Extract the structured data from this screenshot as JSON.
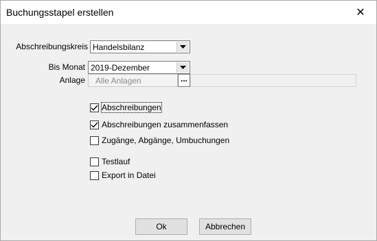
{
  "window": {
    "title": "Buchungsstapel erstellen",
    "close_glyph": "✕"
  },
  "form": {
    "abschreibungskreis": {
      "label": "Abschreibungskreis",
      "value": "Handelsbilanz"
    },
    "bis_monat": {
      "label": "Bis Monat",
      "value": "2019-Dezember"
    },
    "anlage": {
      "label": "Anlage",
      "value": "Alle Anlagen",
      "button_label": "..."
    }
  },
  "options": [
    {
      "label": "Abschreibungen",
      "checked": true,
      "focused": true
    },
    {
      "label": "Abschreibungen zusammenfassen",
      "checked": true,
      "focused": false
    },
    {
      "label": "Zugänge, Abgänge, Umbuchungen",
      "checked": false,
      "focused": false
    },
    {
      "label": "Testlauf",
      "checked": false,
      "focused": false
    },
    {
      "label": "Export in Datei",
      "checked": false,
      "focused": false
    }
  ],
  "buttons": {
    "ok": "Ok",
    "cancel": "Abbrechen"
  },
  "icons": {
    "close": "close-icon",
    "dropdown": "chevron-down-icon",
    "check": "checkmark-icon"
  }
}
